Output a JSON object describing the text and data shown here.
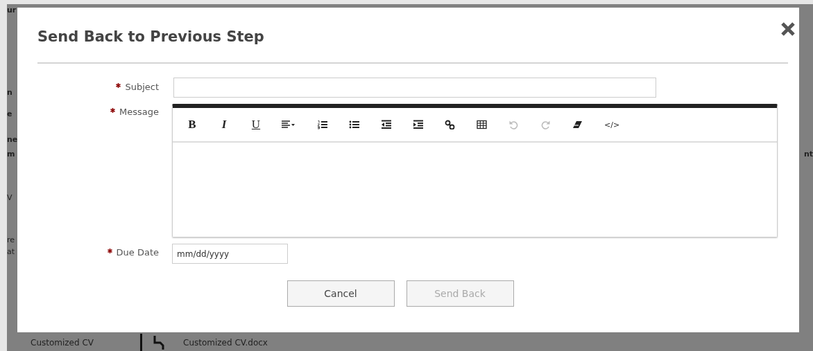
{
  "background": {
    "left_fragments": [
      "ur",
      "n",
      "e",
      "ne",
      "m",
      "V",
      "re",
      "at"
    ],
    "right_fragments": [
      "nt"
    ],
    "files": [
      {
        "name": "Customized CV",
        "file": "Customized CV.docx"
      }
    ]
  },
  "dialog": {
    "title": "Send Back to Previous Step",
    "fields": [
      {
        "kind": "text",
        "label": "Subject",
        "required": true
      },
      {
        "kind": "editor",
        "label": "Message",
        "required": true,
        "toolbar": [
          {
            "kind": "bold",
            "label": "B",
            "disabled": false
          },
          {
            "kind": "italic",
            "label": "I",
            "disabled": false
          },
          {
            "kind": "underline",
            "label": "U",
            "disabled": false
          },
          {
            "kind": "align",
            "disabled": false
          },
          {
            "kind": "ordered-list",
            "disabled": false
          },
          {
            "kind": "bullet-list",
            "disabled": false
          },
          {
            "kind": "outdent",
            "disabled": false
          },
          {
            "kind": "indent",
            "disabled": false
          },
          {
            "kind": "link",
            "disabled": false
          },
          {
            "kind": "table",
            "disabled": false
          },
          {
            "kind": "undo",
            "disabled": true
          },
          {
            "kind": "redo",
            "disabled": true
          },
          {
            "kind": "eraser",
            "disabled": false
          },
          {
            "kind": "code",
            "label": "</>",
            "disabled": false
          }
        ]
      },
      {
        "kind": "date",
        "label": "Due Date",
        "required": true,
        "placeholder": "mm/dd/yyyy"
      }
    ],
    "buttons": [
      {
        "label": "Cancel",
        "disabled": false
      },
      {
        "label": "Send Back",
        "disabled": true
      }
    ]
  }
}
